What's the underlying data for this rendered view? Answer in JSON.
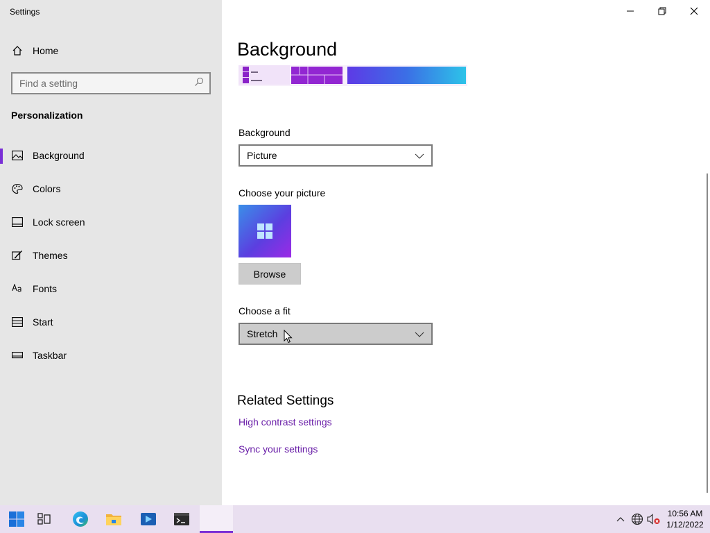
{
  "window": {
    "title": "Settings"
  },
  "sidebar": {
    "home_label": "Home",
    "search_placeholder": "Find a setting",
    "section_title": "Personalization",
    "items": [
      {
        "label": "Background",
        "icon": "picture-icon",
        "selected": true
      },
      {
        "label": "Colors",
        "icon": "palette-icon",
        "selected": false
      },
      {
        "label": "Lock screen",
        "icon": "lock-screen-icon",
        "selected": false
      },
      {
        "label": "Themes",
        "icon": "brush-icon",
        "selected": false
      },
      {
        "label": "Fonts",
        "icon": "fonts-icon",
        "selected": false
      },
      {
        "label": "Start",
        "icon": "start-icon",
        "selected": false
      },
      {
        "label": "Taskbar",
        "icon": "taskbar-icon",
        "selected": false
      }
    ]
  },
  "main": {
    "page_title": "Background",
    "background_label": "Background",
    "background_value": "Picture",
    "choose_picture_label": "Choose your picture",
    "browse_label": "Browse",
    "fit_label": "Choose a fit",
    "fit_value": "Stretch",
    "related_title": "Related Settings",
    "links": [
      "High contrast settings",
      "Sync your settings"
    ]
  },
  "taskbar": {
    "apps": [
      "start-icon",
      "task-view-icon",
      "edge-icon",
      "file-explorer-icon",
      "media-app-icon",
      "terminal-icon",
      "settings-active-icon"
    ],
    "clock_time": "10:56 AM",
    "clock_date": "1/12/2022"
  },
  "colors": {
    "accent": "#7a2fd6",
    "link": "#6a1fa8",
    "sidebar_bg": "#e6e6e6",
    "taskbar_bg": "#e9dff0"
  }
}
